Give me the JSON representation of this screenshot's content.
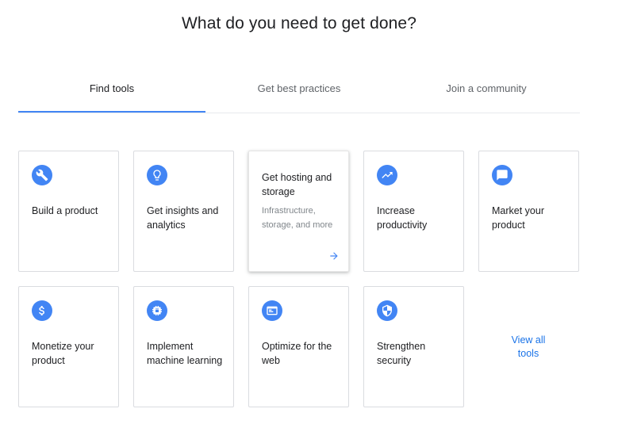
{
  "page": {
    "heading": "What do you need to get done?"
  },
  "tabs": [
    {
      "label": "Find tools",
      "active": true
    },
    {
      "label": "Get best practices",
      "active": false
    },
    {
      "label": "Join a community",
      "active": false
    }
  ],
  "accent_color": "#4285f4",
  "cards": [
    {
      "title": "Build a product",
      "icon": "wrench-icon"
    },
    {
      "title": "Get insights and analytics",
      "icon": "lightbulb-icon"
    },
    {
      "title": "Get hosting and storage",
      "description": "Infrastructure, storage, and more",
      "icon": "arrow-right-icon"
    },
    {
      "title": "Increase productivity",
      "icon": "trending-up-icon"
    },
    {
      "title": "Market your product",
      "icon": "chat-bubble-icon"
    },
    {
      "title": "Monetize your product",
      "icon": "dollar-icon"
    },
    {
      "title": "Implement machine learning",
      "icon": "chip-icon"
    },
    {
      "title": "Optimize for the web",
      "icon": "browser-icon"
    },
    {
      "title": "Strengthen security",
      "icon": "shield-icon"
    }
  ],
  "view_all": {
    "label": "View all tools"
  }
}
